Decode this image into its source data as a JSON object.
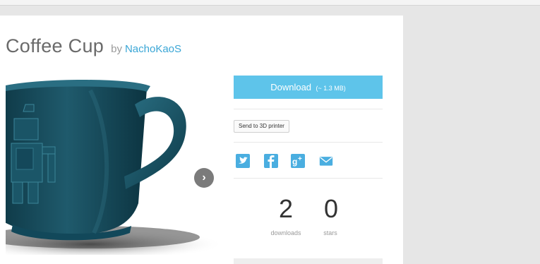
{
  "thing": {
    "title": "Coffee Cup",
    "by_label": "by",
    "author": "NachoKaoS"
  },
  "viewer": {
    "image": "3d-coffee-cup-render",
    "next_icon": "›"
  },
  "actions": {
    "download_label": "Download",
    "download_size": "(~ 1.3 MB)",
    "send_to_printer": "Send to 3D printer"
  },
  "share": {
    "icons": [
      "twitter-icon",
      "facebook-icon",
      "google-plus-icon",
      "email-icon"
    ],
    "color": "#4aaee0"
  },
  "stats": {
    "downloads_value": "2",
    "downloads_label": "downloads",
    "stars_value": "0",
    "stars_label": "stars"
  },
  "colors": {
    "accent": "#5ec4ea",
    "link": "#3aa6d6",
    "mug": "#1d4f60"
  }
}
